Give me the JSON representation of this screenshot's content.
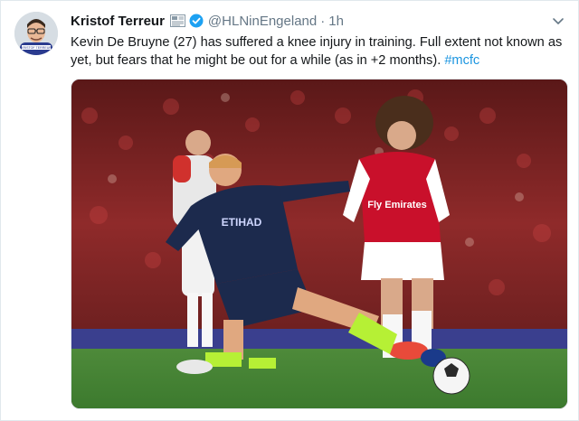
{
  "tweet": {
    "author_name": "Kristof Terreur",
    "handle": "@HLNinEngeland",
    "separator": "·",
    "time": "1h",
    "text_main": "Kevin De Bruyne (27) has suffered a knee injury in training. Full extent not known as yet, but fears that he might be out for a while (as in +2 months).",
    "hashtag": "#mcfc",
    "avatar_caption": "KRISTOF TERREUR",
    "kit_sponsor": "ETIHAD",
    "kit_sponsor_2": "Fly Emirates"
  },
  "colors": {
    "link": "#1b95e0",
    "verified": "#1da1f2",
    "text": "#14171a",
    "muted": "#657786"
  },
  "icons": [
    "newspaper-icon",
    "verified-badge-icon",
    "chevron-down-icon"
  ]
}
